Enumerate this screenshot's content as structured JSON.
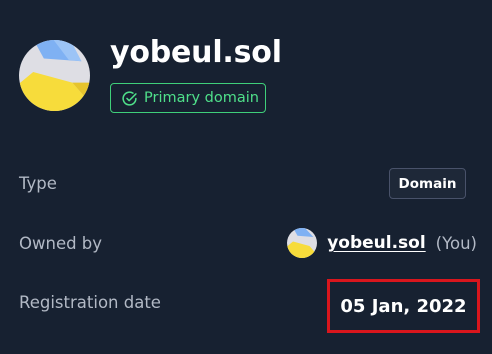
{
  "domain": {
    "name": "yobeul.sol",
    "badge_label": "Primary domain",
    "badge_icon": "check-circle-icon",
    "badge_color": "#4fe08a"
  },
  "details": {
    "type": {
      "label": "Type",
      "value": "Domain"
    },
    "owned_by": {
      "label": "Owned by",
      "owner_name": "yobeul.sol",
      "owner_suffix": "(You)"
    },
    "registration": {
      "label": "Registration date",
      "value": "05 Jan, 2022",
      "highlight_color": "#d9161d"
    }
  },
  "colors": {
    "background": "#172131",
    "text_primary": "#ffffff",
    "text_muted": "#b2b9c5"
  }
}
